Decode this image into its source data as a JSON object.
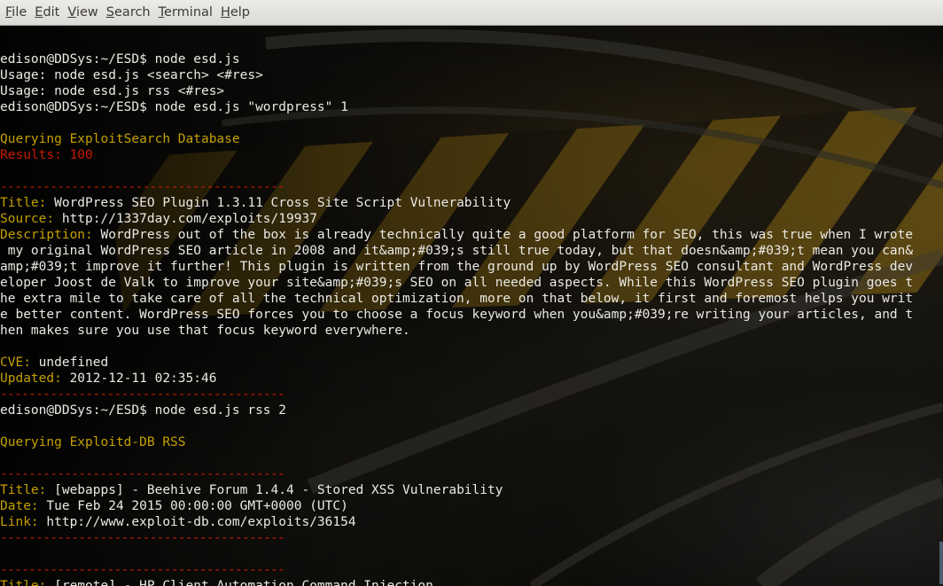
{
  "menu": {
    "file": {
      "acc": "F",
      "rest": "ile"
    },
    "edit": {
      "acc": "E",
      "rest": "dit"
    },
    "view": {
      "acc": "V",
      "rest": "iew"
    },
    "search": {
      "acc": "S",
      "rest": "earch"
    },
    "terminal": {
      "acc": "T",
      "rest": "erminal"
    },
    "help": {
      "acc": "H",
      "rest": "elp"
    }
  },
  "colors": {
    "label": "#c4a000",
    "error": "#c91b00",
    "text": "#eae9e4",
    "menu_bg": "#dcdad5"
  },
  "terminal": {
    "lines": [
      {
        "type": "blank"
      },
      {
        "type": "text",
        "text": "edison@DDSys:~/ESD$ node esd.js"
      },
      {
        "type": "text",
        "text": "Usage: node esd.js <search> <#res>"
      },
      {
        "type": "text",
        "text": "Usage: node esd.js rss <#res>"
      },
      {
        "type": "text",
        "text": "edison@DDSys:~/ESD$ node esd.js \"wordpress\" 1"
      },
      {
        "type": "blank"
      },
      {
        "type": "yellow",
        "text": "Querying ExploitSearch Database"
      },
      {
        "type": "red",
        "text": "Results: 100"
      },
      {
        "type": "blank"
      },
      {
        "type": "dash",
        "text": "----------------------------------------"
      },
      {
        "type": "field",
        "label": "Title:",
        "value": " WordPress SEO Plugin 1.3.11 Cross Site Script Vulnerability"
      },
      {
        "type": "field",
        "label": "Source:",
        "value": " http://1337day.com/exploits/19937"
      },
      {
        "type": "field",
        "label": "Description:",
        "value": " WordPress out of the box is already technically quite a good platform for SEO, this was true when I wrote"
      },
      {
        "type": "text",
        "text": " my original WordPress SEO article in 2008 and it&amp;#039;s still true today, but that doesn&amp;#039;t mean you can&"
      },
      {
        "type": "text",
        "text": "amp;#039;t improve it further! This plugin is written from the ground up by WordPress SEO consultant and WordPress dev"
      },
      {
        "type": "text",
        "text": "eloper Joost de Valk to improve your site&amp;#039;s SEO on all needed aspects. While this WordPress SEO plugin goes t"
      },
      {
        "type": "text",
        "text": "he extra mile to take care of all the technical optimization, more on that below, it first and foremost helps you writ"
      },
      {
        "type": "text",
        "text": "e better content. WordPress SEO forces you to choose a focus keyword when you&amp;#039;re writing your articles, and t"
      },
      {
        "type": "text",
        "text": "hen makes sure you use that focus keyword everywhere."
      },
      {
        "type": "blank"
      },
      {
        "type": "field",
        "label": "CVE:",
        "value": " undefined"
      },
      {
        "type": "field",
        "label": "Updated:",
        "value": " 2012-12-11 02:35:46"
      },
      {
        "type": "dash",
        "text": "----------------------------------------"
      },
      {
        "type": "text",
        "text": "edison@DDSys:~/ESD$ node esd.js rss 2"
      },
      {
        "type": "blank"
      },
      {
        "type": "yellow",
        "text": "Querying Exploitd-DB RSS"
      },
      {
        "type": "blank"
      },
      {
        "type": "dash",
        "text": "----------------------------------------"
      },
      {
        "type": "field",
        "label": "Title:",
        "value": " [webapps] - Beehive Forum 1.4.4 - Stored XSS Vulnerability"
      },
      {
        "type": "field",
        "label": "Date:",
        "value": " Tue Feb 24 2015 00:00:00 GMT+0000 (UTC)"
      },
      {
        "type": "field",
        "label": "Link:",
        "value": " http://www.exploit-db.com/exploits/36154"
      },
      {
        "type": "dash",
        "text": "----------------------------------------"
      },
      {
        "type": "blank"
      },
      {
        "type": "dash",
        "text": "----------------------------------------"
      },
      {
        "type": "field",
        "label": "Title:",
        "value": " [remote] - HP Client Automation Command Injection"
      }
    ]
  }
}
